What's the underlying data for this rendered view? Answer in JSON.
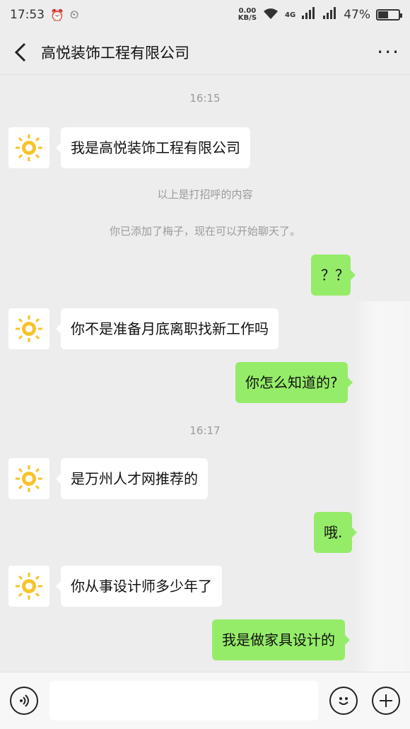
{
  "status_bar": {
    "time": "17:53",
    "speed_value": "0.00",
    "speed_unit": "KB/S",
    "network": "4G",
    "battery_percent": "47%"
  },
  "header": {
    "back_icon": "chevron-left-icon",
    "title": "高悦装饰工程有限公司",
    "more_icon": "more-dots-icon"
  },
  "chat": {
    "time1": "16:15",
    "msg1": "我是高悦装饰工程有限公司",
    "sys1": "以上是打招呼的内容",
    "sys2": "你已添加了梅子，现在可以开始聊天了。",
    "msg2": "？？",
    "msg3": "你不是准备月底离职找新工作吗",
    "msg4": "你怎么知道的?",
    "time2": "16:17",
    "msg5": "是万州人才网推荐的",
    "msg6": "哦.",
    "msg7": "你从事设计师多少年了",
    "msg8": "我是做家具设计的"
  },
  "input_bar": {
    "voice_icon": "voice-icon",
    "emoji_icon": "emoji-icon",
    "plus_icon": "plus-icon",
    "input_value": ""
  },
  "colors": {
    "background": "#ededed",
    "outgoing_bubble": "#95ec69",
    "incoming_bubble": "#ffffff"
  }
}
